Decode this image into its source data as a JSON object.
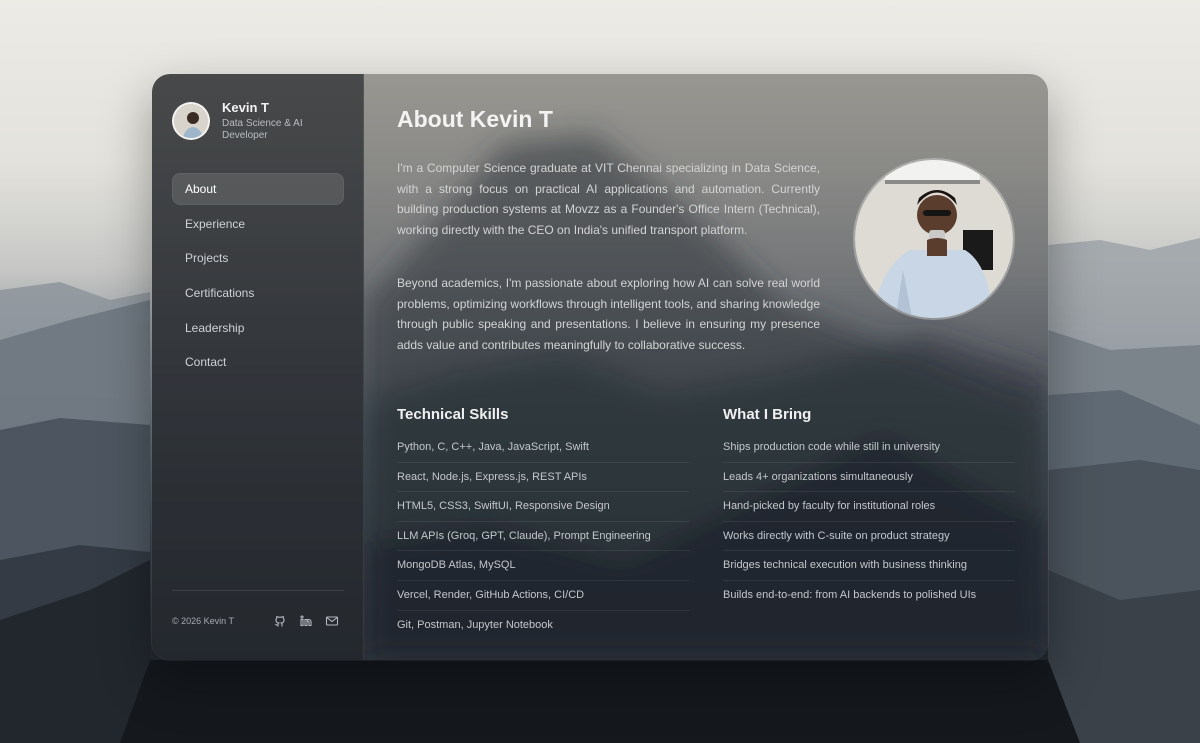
{
  "profile": {
    "name": "Kevin T",
    "role": "Data Science & AI Developer"
  },
  "nav": {
    "items": [
      {
        "label": "About",
        "active": true
      },
      {
        "label": "Experience",
        "active": false
      },
      {
        "label": "Projects",
        "active": false
      },
      {
        "label": "Certifications",
        "active": false
      },
      {
        "label": "Leadership",
        "active": false
      },
      {
        "label": "Contact",
        "active": false
      }
    ]
  },
  "footer": {
    "copyright": "© 2026 Kevin T",
    "icons": [
      "github-icon",
      "linkedin-icon",
      "mail-icon"
    ]
  },
  "about": {
    "title": "About Kevin T",
    "paragraph1": "I'm a Computer Science graduate at VIT Chennai specializing in Data Science, with a strong focus on practical AI applications and automation. Currently building production systems at Movzz as a Founder's Office Intern (Technical), working directly with the CEO on India's unified transport platform.",
    "paragraph2": "Beyond academics, I'm passionate about exploring how AI can solve real world problems, optimizing workflows through intelligent tools, and sharing knowledge through public speaking and presentations. I believe in ensuring my presence adds value and contributes meaningfully to collaborative success."
  },
  "skills": {
    "title": "Technical Skills",
    "items": [
      "Python, C, C++, Java, JavaScript, Swift",
      "React, Node.js, Express.js, REST APIs",
      "HTML5, CSS3, SwiftUI, Responsive Design",
      "LLM APIs (Groq, GPT, Claude), Prompt Engineering",
      "MongoDB Atlas, MySQL",
      "Vercel, Render, GitHub Actions, CI/CD",
      "Git, Postman, Jupyter Notebook"
    ]
  },
  "bring": {
    "title": "What I Bring",
    "items": [
      "Ships production code while still in university",
      "Leads 4+ organizations simultaneously",
      "Hand-picked by faculty for institutional roles",
      "Works directly with C-suite on product strategy",
      "Bridges technical execution with business thinking",
      "Builds end-to-end: from AI backends to polished UIs"
    ]
  }
}
